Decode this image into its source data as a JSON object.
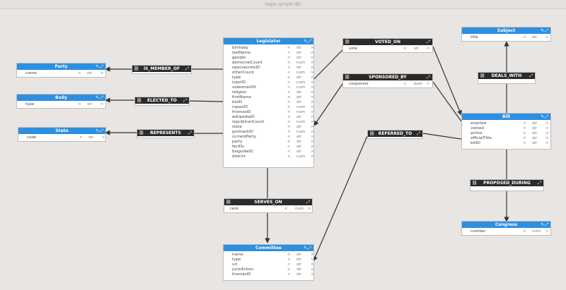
{
  "window": {
    "title": "legis-graph.db"
  },
  "icons": {
    "pin": "pin-icon",
    "expand": "expand-icon",
    "link": "link-icon"
  },
  "colors": {
    "node_header": "#2d8fe0",
    "rel_header": "#2b2b2b",
    "canvas": "#e8e5e3"
  },
  "nodes": {
    "legislator": {
      "title": "Legislator",
      "props": [
        [
          "birthday",
          "str"
        ],
        [
          "lastName",
          "str"
        ],
        [
          "gender",
          "str"
        ],
        [
          "democratCount",
          "num"
        ],
        [
          "opensecretsID",
          "str"
        ],
        [
          "otherCount",
          "num"
        ],
        [
          "type",
          "str"
        ],
        [
          "icpsrID",
          "num"
        ],
        [
          "votesmartID",
          "num"
        ],
        [
          "religion",
          "str"
        ],
        [
          "firstName",
          "str"
        ],
        [
          "bioID",
          "str"
        ],
        [
          "cspanID",
          "num"
        ],
        [
          "thomasID",
          "num"
        ],
        [
          "wikipediaID",
          "str"
        ],
        [
          "republicanCount",
          "num"
        ],
        [
          "state",
          "str"
        ],
        [
          "govtrackID",
          "num"
        ],
        [
          "currentParty",
          "str"
        ],
        [
          "party",
          "str"
        ],
        [
          "fecIDs",
          "str"
        ],
        [
          "bioguideID",
          "str"
        ],
        [
          "district",
          "num"
        ]
      ]
    },
    "party": {
      "title": "Party",
      "props": [
        [
          "name",
          "str"
        ]
      ]
    },
    "body": {
      "title": "Body",
      "props": [
        [
          "type",
          "str"
        ]
      ]
    },
    "state": {
      "title": "State",
      "props": [
        [
          "code",
          "str"
        ]
      ]
    },
    "subject": {
      "title": "Subject",
      "props": [
        [
          "title",
          "str"
        ]
      ]
    },
    "bill": {
      "title": "Bill",
      "props": [
        [
          "enacted",
          "str"
        ],
        [
          "vetoed",
          "str"
        ],
        [
          "active",
          "str"
        ],
        [
          "officialTitle",
          "str"
        ],
        [
          "billID",
          "str"
        ]
      ]
    },
    "congress": {
      "title": "Congress",
      "props": [
        [
          "number",
          "num"
        ]
      ]
    },
    "committee": {
      "title": "Committee",
      "props": [
        [
          "name",
          "str"
        ],
        [
          "type",
          "str"
        ],
        [
          "url",
          "str"
        ],
        [
          "jurisdiction",
          "str"
        ],
        [
          "thomasID",
          "str"
        ]
      ]
    }
  },
  "relationships": {
    "is_member_of": {
      "title": "IS_MEMBER_OF",
      "props": []
    },
    "elected_to": {
      "title": "ELECTED_TO",
      "props": []
    },
    "represents": {
      "title": "REPRESENTS",
      "props": []
    },
    "voted_on": {
      "title": "VOTED_ON",
      "props": [
        [
          "vote",
          "str"
        ]
      ]
    },
    "sponsored_by": {
      "title": "SPONSORED_BY",
      "props": [
        [
          "cosponsor",
          "bool"
        ]
      ]
    },
    "deals_with": {
      "title": "DEALS_WITH",
      "props": []
    },
    "referred_to": {
      "title": "REFERRED_TO",
      "props": []
    },
    "proposed_during": {
      "title": "PROPOSED_DURING",
      "props": []
    },
    "serves_on": {
      "title": "SERVES_ON",
      "props": [
        [
          "rank",
          "num"
        ]
      ]
    }
  }
}
